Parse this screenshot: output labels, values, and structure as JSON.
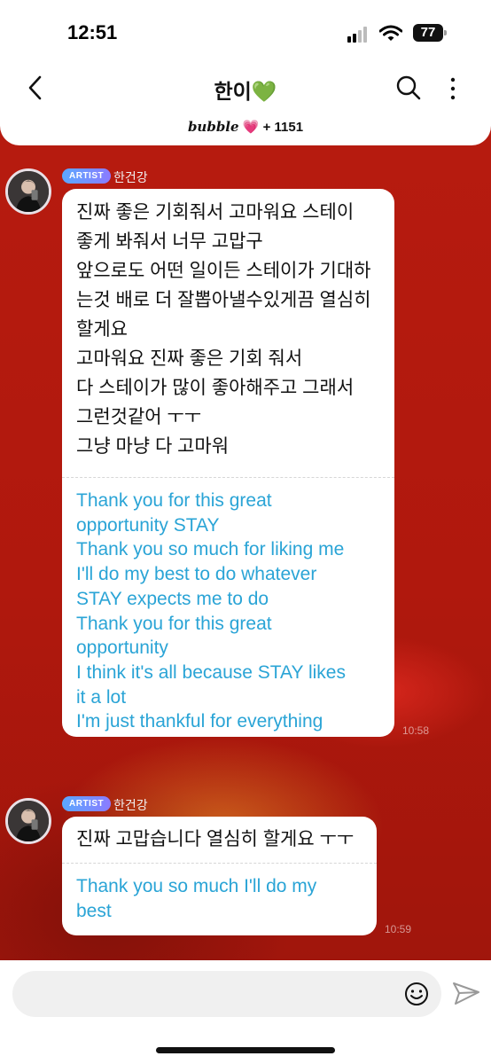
{
  "status": {
    "time": "12:51",
    "battery": "77"
  },
  "header": {
    "title": "한이💚",
    "bubble_word": "bubble",
    "heart": "💗",
    "count": "+ 1151"
  },
  "icons": {
    "back": "chevron-left-icon",
    "search": "search-icon",
    "more": "more-vertical-icon",
    "emoji": "smile-icon",
    "send": "send-icon"
  },
  "messages": [
    {
      "badge": "ARTIST",
      "sender": "한건강",
      "ko_lines": [
        "진짜 좋은 기회줘서 고마워요 스테이",
        "좋게 봐줘서 너무 고맙구",
        "앞으로도 어떤 일이든 스테이가 기대하",
        "는것 배로 더 잘뽑아낼수있게끔 열심히",
        "할게요",
        "고마워요 진짜 좋은 기회 줘서",
        "다 스테이가 많이 좋아해주고 그래서",
        "그런것같어 ㅜㅜ",
        "그냥 마냥 다 고마워"
      ],
      "en_lines": [
        "Thank you for this great",
        "opportunity STAY",
        "Thank you so much for liking me",
        "I'll do my best to do whatever",
        "STAY expects me to do",
        "Thank you for this great",
        "opportunity",
        "I think it's all because STAY likes",
        "it a lot",
        "I'm just thankful for everything"
      ],
      "time": "10:58"
    },
    {
      "badge": "ARTIST",
      "sender": "한건강",
      "ko_lines": [
        "진짜 고맙습니다 열심히 할게요 ㅜㅜ"
      ],
      "en_lines": [
        "Thank you so much I'll do my",
        "best"
      ],
      "time": "10:59"
    }
  ],
  "colors": {
    "translation": "#2aa4d6",
    "badge": "#6f95ff",
    "background": "#b51a10"
  },
  "input": {
    "placeholder": ""
  }
}
